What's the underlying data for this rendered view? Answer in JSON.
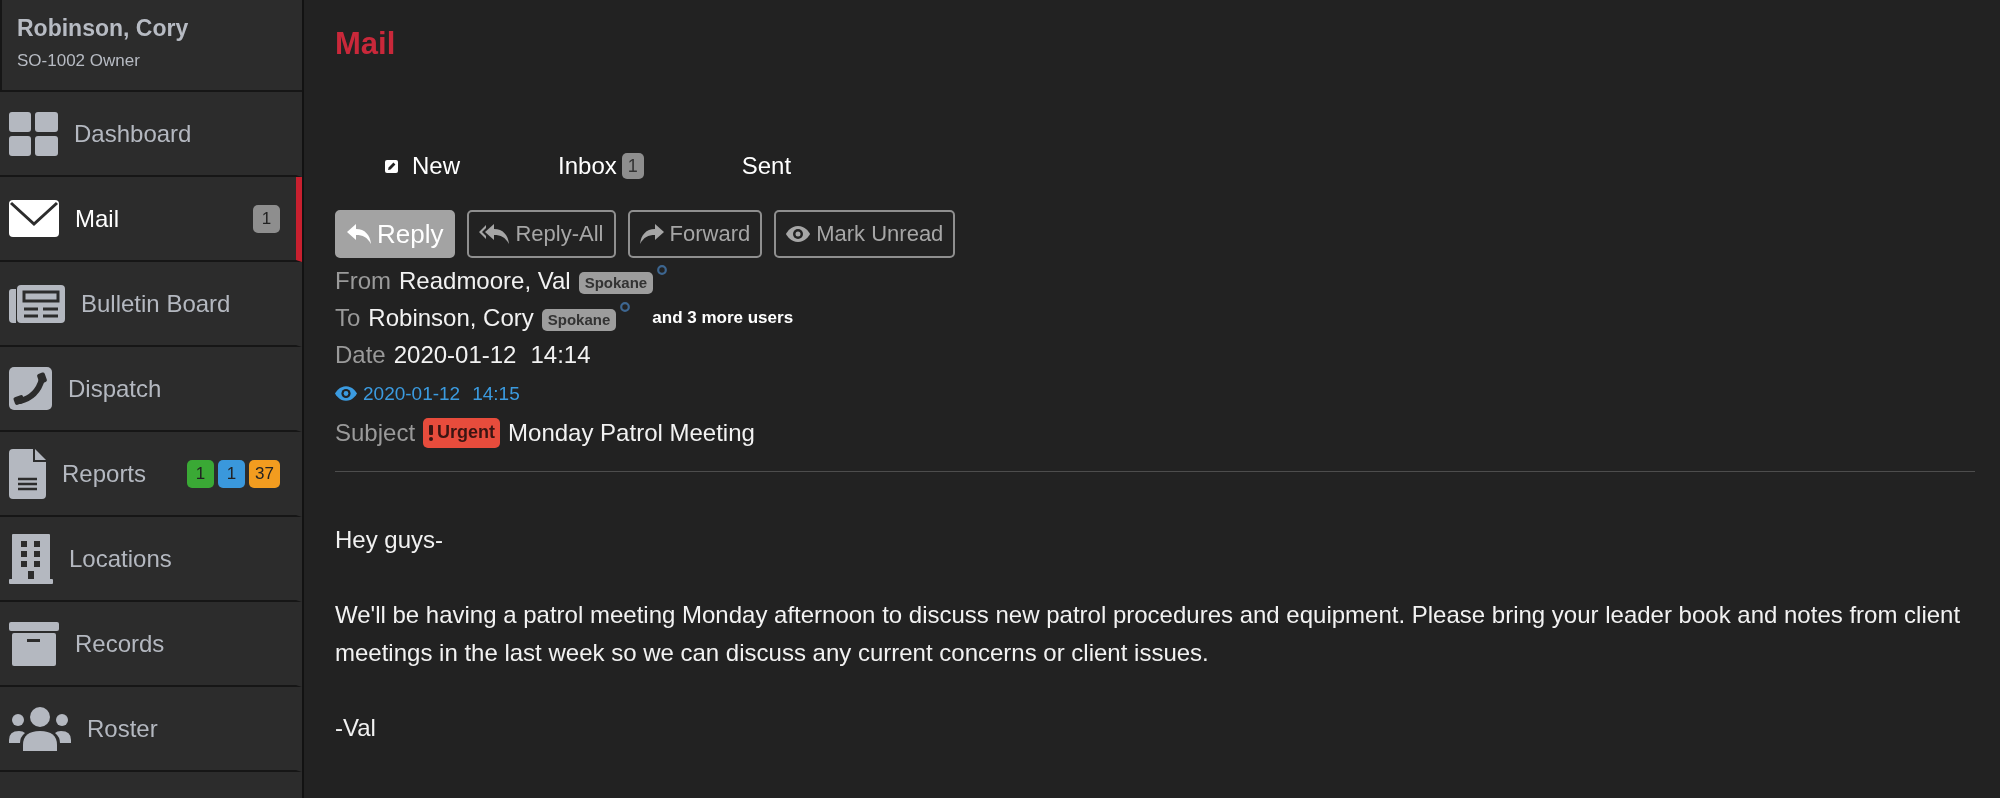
{
  "user": {
    "name": "Robinson, Cory",
    "role": "SO-1002 Owner"
  },
  "sidebar": {
    "items": [
      {
        "label": "Dashboard",
        "selected": false
      },
      {
        "label": "Mail",
        "selected": true,
        "badges": [
          {
            "text": "1",
            "color": "#8e8e8e"
          }
        ]
      },
      {
        "label": "Bulletin Board",
        "selected": false
      },
      {
        "label": "Dispatch",
        "selected": false
      },
      {
        "label": "Reports",
        "selected": false,
        "badges": [
          {
            "text": "1",
            "color": "#3aa935"
          },
          {
            "text": "1",
            "color": "#3a98dc"
          },
          {
            "text": "37",
            "color": "#f29c1f"
          }
        ]
      },
      {
        "label": "Locations",
        "selected": false
      },
      {
        "label": "Records",
        "selected": false
      },
      {
        "label": "Roster",
        "selected": false
      }
    ]
  },
  "page_title": "Mail",
  "tabs": [
    {
      "label": "New"
    },
    {
      "label": "Inbox",
      "badge": "1"
    },
    {
      "label": "Sent"
    }
  ],
  "actions": [
    {
      "label": "Reply",
      "kind": "filled"
    },
    {
      "label": "Reply-All",
      "kind": "outline"
    },
    {
      "label": "Forward",
      "kind": "outline"
    },
    {
      "label": "Mark Unread",
      "kind": "outline"
    }
  ],
  "message": {
    "from": {
      "label": "From",
      "name": "Readmoore, Val",
      "tag": "Spokane"
    },
    "to": {
      "label": "To",
      "name": "Robinson, Cory",
      "tag": "Spokane",
      "more": "and 3 more users"
    },
    "date": {
      "label": "Date",
      "day": "2020-01-12",
      "time": "14:14"
    },
    "read": {
      "day": "2020-01-12",
      "time": "14:15"
    },
    "subject": {
      "label": "Subject",
      "priority": "Urgent",
      "text": "Monday Patrol Meeting"
    },
    "body": [
      "Hey guys-",
      "We'll be having a patrol meeting Monday afternoon to discuss new patrol procedures and equipment. Please bring your leader book and notes from client meetings in the last week so we can discuss any current concerns or client issues.",
      "-Val"
    ]
  }
}
